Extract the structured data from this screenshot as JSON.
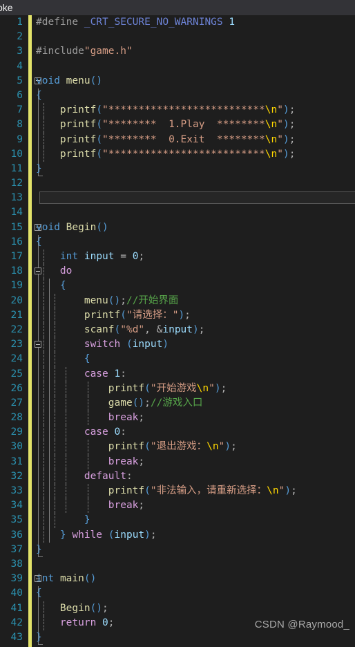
{
  "titlebar": {
    "tab_label": "oke"
  },
  "watermark": {
    "text": "CSDN @Raymood_"
  },
  "editor": {
    "language": "C",
    "first_line": 1,
    "last_line": 43,
    "colors": {
      "background": "#1e1e1e",
      "titlebar": "#333337",
      "line_number": "#2b91af",
      "change_strip": "#e3e36a",
      "keyword": "#569cd6",
      "control_keyword": "#d8a0df",
      "string": "#d69d85",
      "escape": "#ffd700",
      "comment": "#57a64a",
      "function": "#dcdcaa",
      "identifier": "#9cdcfe",
      "preprocessor": "#9b9b9b",
      "macro": "#6d83d6",
      "watermark": "#a8a8a8"
    },
    "lines": [
      {
        "n": 1,
        "text": "#define _CRT_SECURE_NO_WARNINGS 1"
      },
      {
        "n": 2,
        "text": ""
      },
      {
        "n": 3,
        "text": "#include\"game.h\""
      },
      {
        "n": 4,
        "text": ""
      },
      {
        "n": 5,
        "text": "void menu()"
      },
      {
        "n": 6,
        "text": "{"
      },
      {
        "n": 7,
        "text": "    printf(\"**************************\\n\");"
      },
      {
        "n": 8,
        "text": "    printf(\"********  1.Play  ********\\n\");"
      },
      {
        "n": 9,
        "text": "    printf(\"********  0.Exit  ********\\n\");"
      },
      {
        "n": 10,
        "text": "    printf(\"**************************\\n\");"
      },
      {
        "n": 11,
        "text": "}"
      },
      {
        "n": 12,
        "text": ""
      },
      {
        "n": 13,
        "text": ""
      },
      {
        "n": 14,
        "text": ""
      },
      {
        "n": 15,
        "text": "void Begin()"
      },
      {
        "n": 16,
        "text": "{"
      },
      {
        "n": 17,
        "text": "    int input = 0;"
      },
      {
        "n": 18,
        "text": "    do"
      },
      {
        "n": 19,
        "text": "    {"
      },
      {
        "n": 20,
        "text": "        menu();//开始界面"
      },
      {
        "n": 21,
        "text": "        printf(\"请选择：\");"
      },
      {
        "n": 22,
        "text": "        scanf(\"%d\", &input);"
      },
      {
        "n": 23,
        "text": "        switch (input)"
      },
      {
        "n": 24,
        "text": "        {"
      },
      {
        "n": 25,
        "text": "        case 1:"
      },
      {
        "n": 26,
        "text": "            printf(\"开始游戏\\n\");"
      },
      {
        "n": 27,
        "text": "            game();//游戏入口"
      },
      {
        "n": 28,
        "text": "            break;"
      },
      {
        "n": 29,
        "text": "        case 0:"
      },
      {
        "n": 30,
        "text": "            printf(\"退出游戏：\\n\");"
      },
      {
        "n": 31,
        "text": "            break;"
      },
      {
        "n": 32,
        "text": "        default:"
      },
      {
        "n": 33,
        "text": "            printf(\"非法输入，请重新选择：\\n\");"
      },
      {
        "n": 34,
        "text": "            break;"
      },
      {
        "n": 35,
        "text": "        }"
      },
      {
        "n": 36,
        "text": "    } while (input);"
      },
      {
        "n": 37,
        "text": "}"
      },
      {
        "n": 38,
        "text": ""
      },
      {
        "n": 39,
        "text": "int main()"
      },
      {
        "n": 40,
        "text": "{"
      },
      {
        "n": 41,
        "text": "    Begin();"
      },
      {
        "n": 42,
        "text": "    return 0;"
      },
      {
        "n": 43,
        "text": "}"
      }
    ]
  }
}
